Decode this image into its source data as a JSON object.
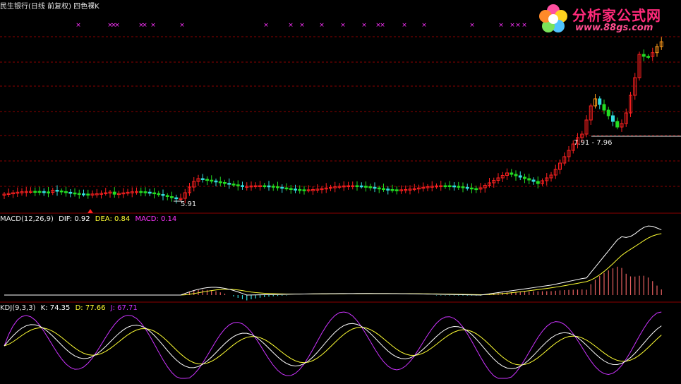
{
  "main_panel": {
    "title": "民生银行(日线 前复权) 四色裸K",
    "low_label": "5.91",
    "range_label": "7.91 - 7.96"
  },
  "macd_panel": {
    "name": "MACD(12,26,9)",
    "dif_label": "DIF: 0.92",
    "dea_label": "DEA: 0.84",
    "macd_label": "MACD: 0.14"
  },
  "kdj_panel": {
    "name": "KDJ(9,3,3)",
    "k_label": "K: 74.35",
    "d_label": "D: 77.66",
    "j_label": "J: 67.71"
  },
  "watermark": {
    "text": "分析家公式网",
    "url": "www.88gs.com"
  },
  "colors": {
    "background": "#000000",
    "grid": "#8b0000",
    "rise": "#ff2020",
    "rise_orange": "#ff9a1a",
    "fall_green": "#22dd22",
    "fall_cyan": "#33dddd",
    "macd_bar": "#e86060",
    "dif": "#ffffff",
    "dea": "#ffff33",
    "macd_text": "#ff33ff",
    "kdj_k": "#ffffff",
    "kdj_d": "#ffff33",
    "kdj_j": "#cc33ff",
    "marker": "#ff33ff"
  },
  "chart_data": {
    "type": "candlestick",
    "series_count": 3,
    "summary": {
      "low": 5.91,
      "recent_range": [
        7.91,
        7.96
      ],
      "dif": 0.92,
      "dea": 0.84,
      "macd": 0.14,
      "k": 74.35,
      "d": 77.66,
      "j": 67.71
    }
  }
}
